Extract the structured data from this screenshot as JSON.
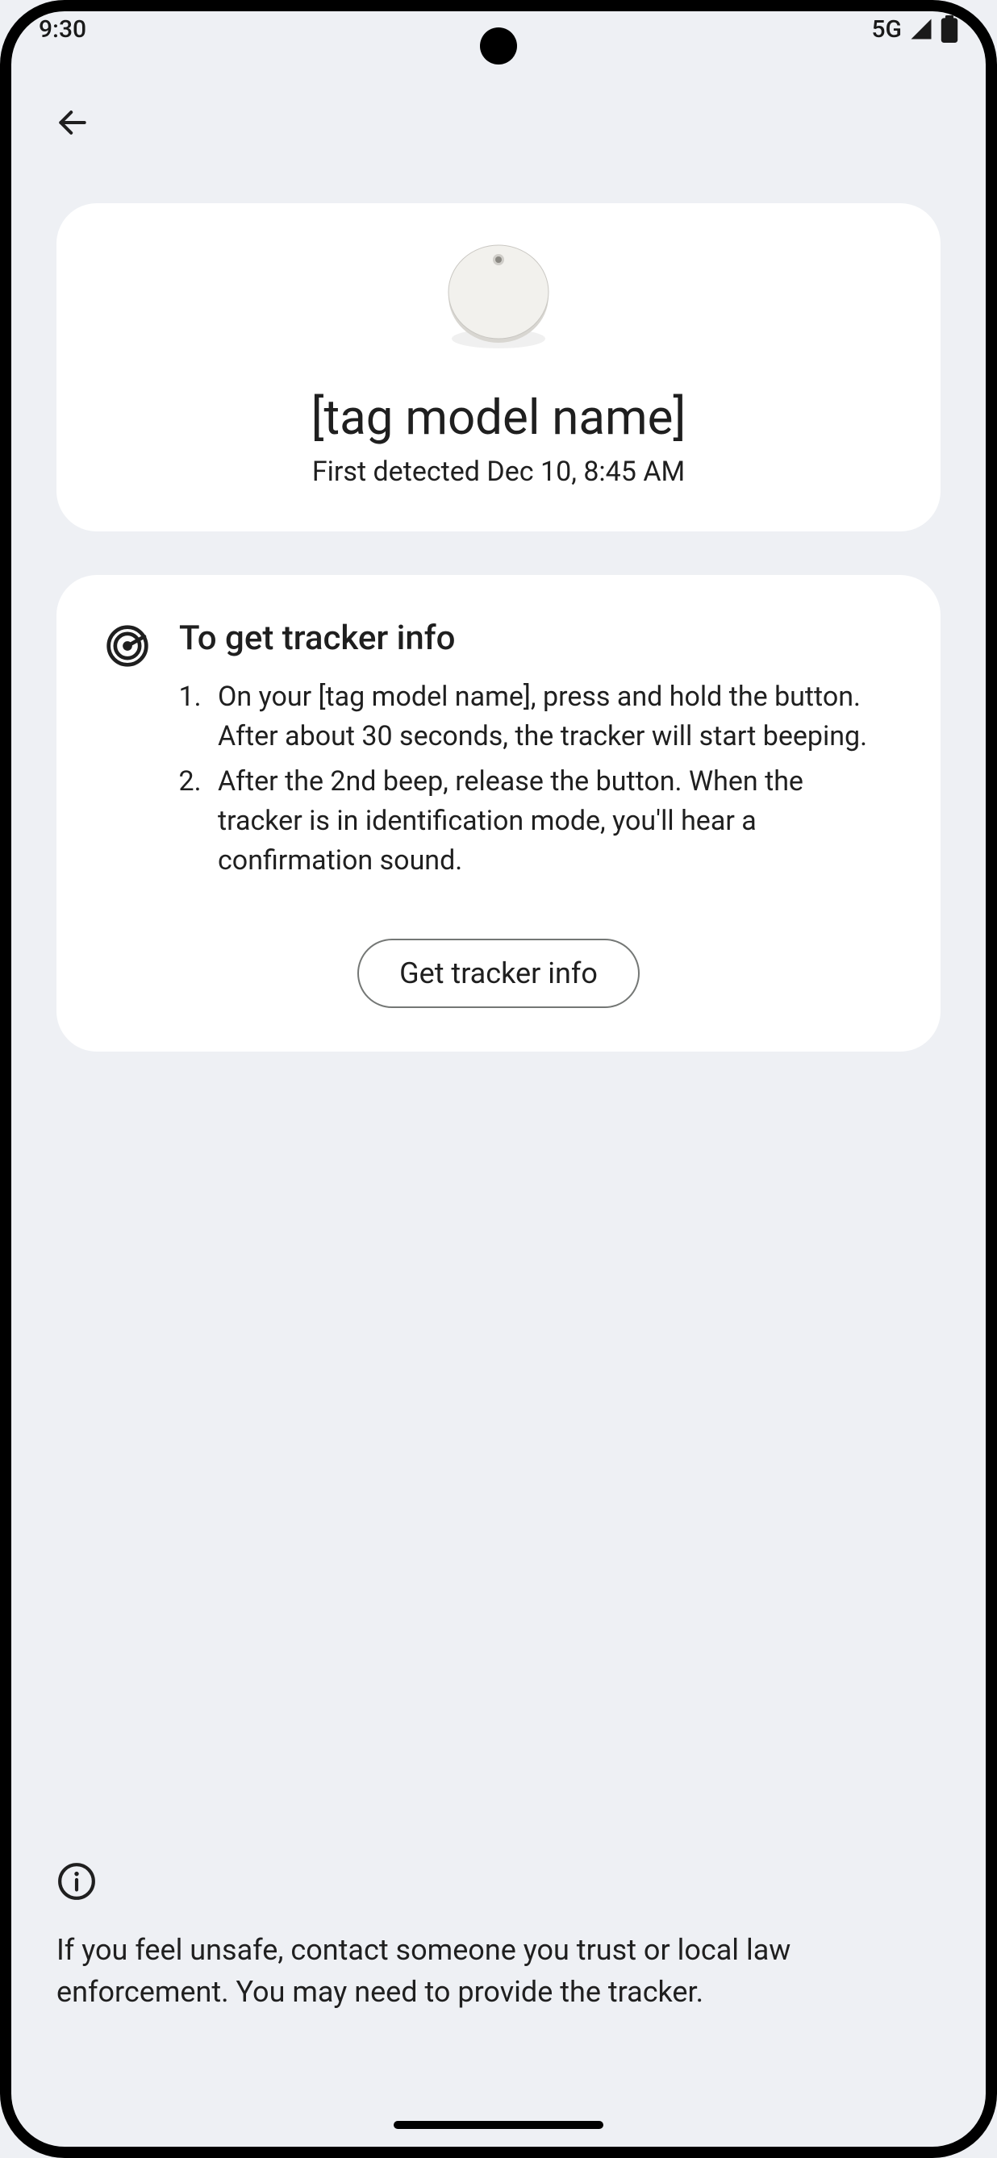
{
  "status": {
    "time": "9:30",
    "network": "5G"
  },
  "hero": {
    "title": "[tag model name]",
    "subtitle": "First detected Dec 10, 8:45 AM"
  },
  "info": {
    "title": "To get tracker info",
    "steps": [
      "On your [tag model name], press and hold the button. After about 30 seconds, the tracker will start beeping.",
      "After the 2nd beep, release the button. When the tracker is in identification mode, you'll hear a confirmation sound."
    ],
    "button_label": "Get tracker info"
  },
  "safety_note": "If you feel unsafe, contact someone you trust or local law enforcement. You may need to provide the tracker."
}
